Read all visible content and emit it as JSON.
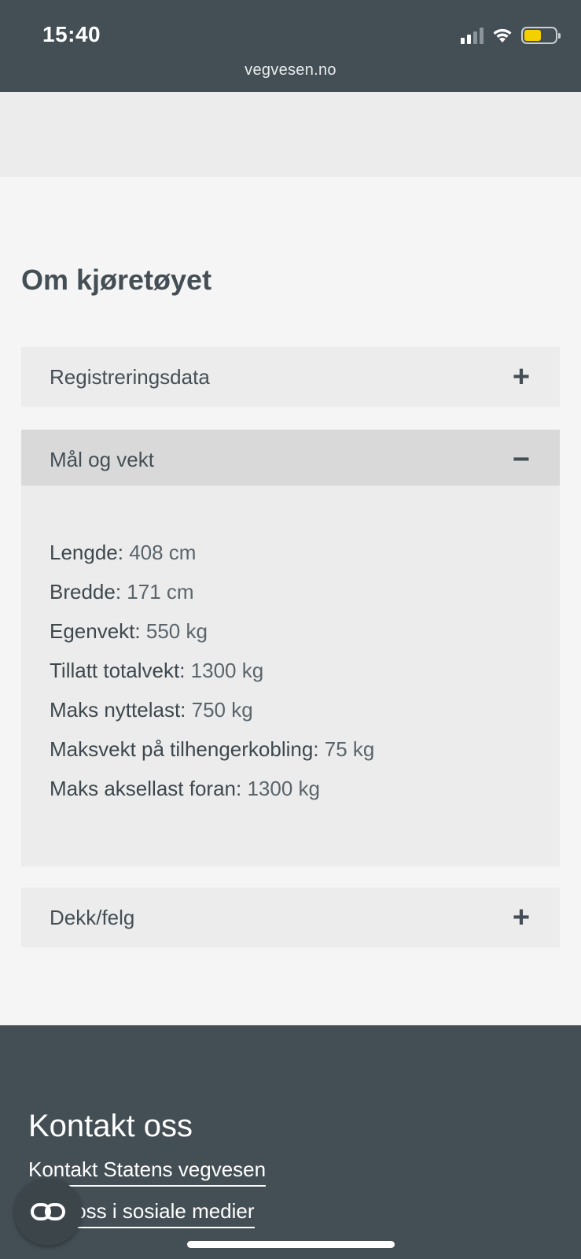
{
  "status_bar": {
    "time": "15:40",
    "url": "vegvesen.no",
    "icons": [
      "signal-icon",
      "wifi-icon",
      "battery-icon"
    ],
    "battery_level": 0.55,
    "battery_color": "#f5d000"
  },
  "section": {
    "title": "Om kjøretøyet",
    "accordions": [
      {
        "label": "Registreringsdata",
        "toggle": "+",
        "expanded": false
      },
      {
        "label": "Mål og vekt",
        "toggle": "−",
        "expanded": true
      },
      {
        "label": "Dekk/felg",
        "toggle": "+",
        "expanded": false
      }
    ],
    "measurements": [
      {
        "key": "Lengde:",
        "value": " 408 cm"
      },
      {
        "key": "Bredde:",
        "value": " 171 cm"
      },
      {
        "key": "Egenvekt:",
        "value": " 550 kg"
      },
      {
        "key": "Tillatt totalvekt:",
        "value": " 1300 kg"
      },
      {
        "key": "Maks nyttelast:",
        "value": " 750 kg"
      },
      {
        "key": "Maksvekt på tilhengerkobling:",
        "value": " 75 kg"
      },
      {
        "key": "Maks aksellast foran:",
        "value": " 1300 kg"
      }
    ]
  },
  "footer": {
    "title": "Kontakt oss",
    "links": [
      "Kontakt Statens vegvesen",
      "Følg oss i sosiale medier"
    ]
  },
  "fab_icon": "link-icon",
  "colors": {
    "header_bg": "#444f55",
    "footer_bg": "#444f55",
    "accordion_bg": "#ececec",
    "accordion_open_bg": "#d9d9d9",
    "text": "#444f55"
  }
}
